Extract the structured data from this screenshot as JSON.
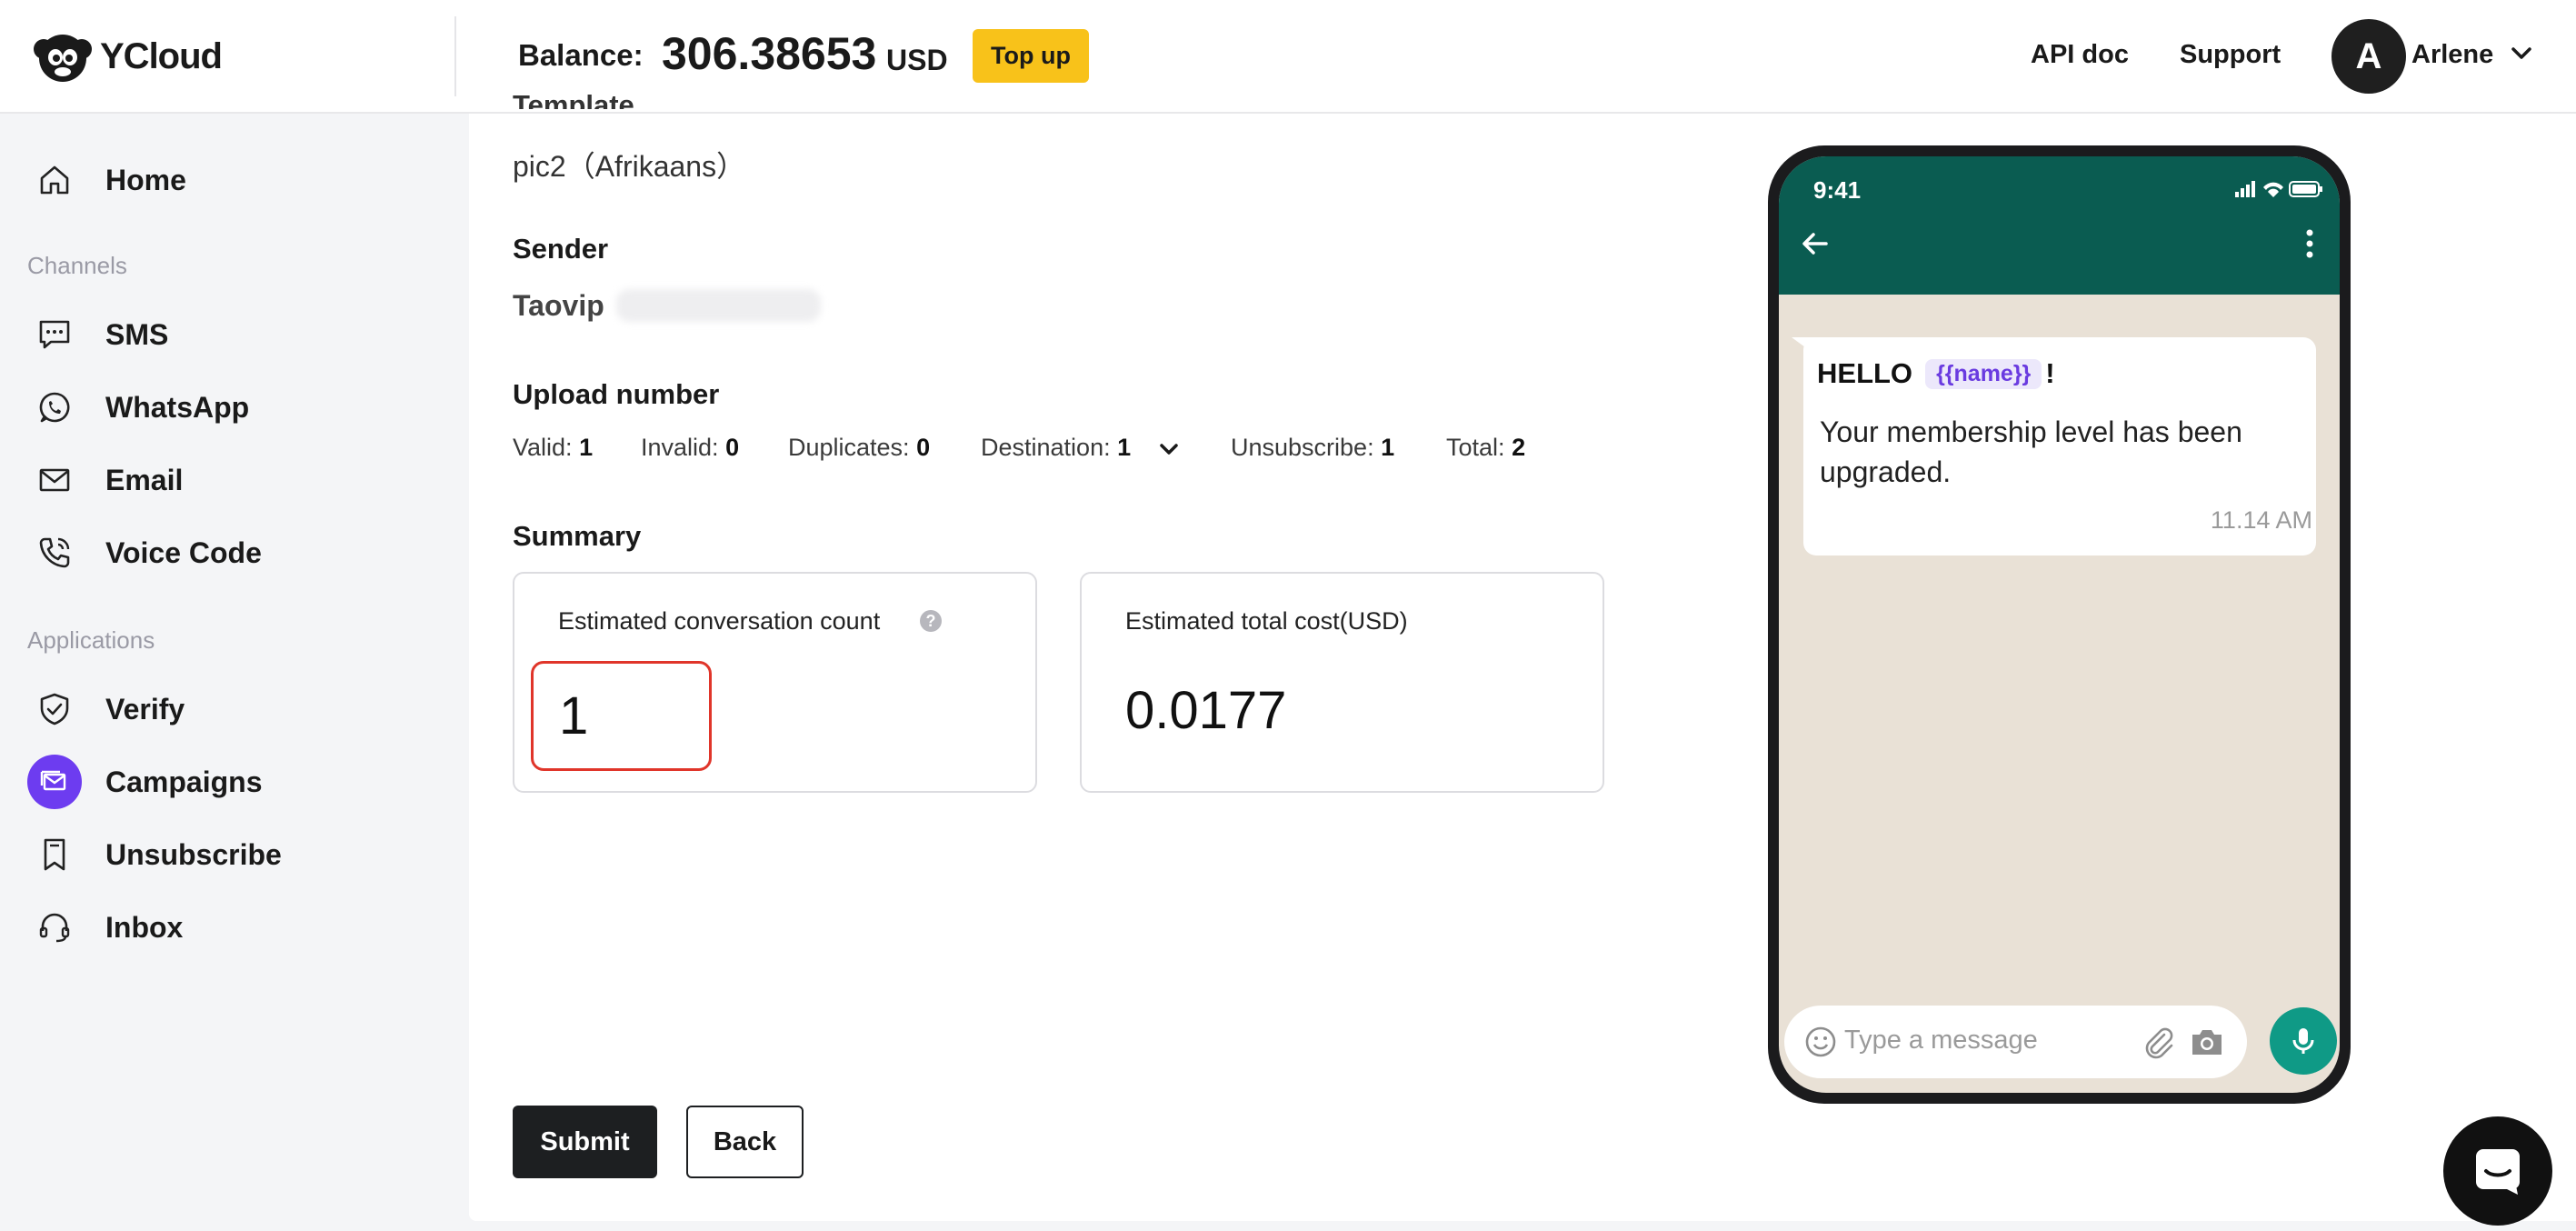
{
  "header": {
    "logo_text": "YCloud",
    "balance_label": "Balance:",
    "balance_amount": "306.38653",
    "balance_currency": "USD",
    "topup_label": "Top up",
    "api_doc_label": "API doc",
    "support_label": "Support",
    "user_initial": "A",
    "user_name": "Arlene"
  },
  "sidebar": {
    "home": "Home",
    "channels_heading": "Channels",
    "sms": "SMS",
    "whatsapp": "WhatsApp",
    "email": "Email",
    "voice_code": "Voice Code",
    "applications_heading": "Applications",
    "verify": "Verify",
    "campaigns": "Campaigns",
    "unsubscribe": "Unsubscribe",
    "inbox": "Inbox",
    "active_item": "Campaigns",
    "accent_color": "#6d3cf0"
  },
  "form": {
    "template_title_cut": "Template",
    "template_value": "pic2（Afrikaans）",
    "sender_title": "Sender",
    "sender_value": "Taovip",
    "upload_title": "Upload number",
    "stats": {
      "valid_label": "Valid:",
      "valid": "1",
      "invalid_label": "Invalid:",
      "invalid": "0",
      "duplicates_label": "Duplicates:",
      "duplicates": "0",
      "destination_label": "Destination:",
      "destination": "1",
      "unsubscribe_label": "Unsubscribe:",
      "unsubscribe": "1",
      "total_label": "Total:",
      "total": "2"
    },
    "summary_title": "Summary",
    "conv_count_label": "Estimated conversation count",
    "conv_count_value": "1",
    "total_cost_label": "Estimated total cost(USD)",
    "total_cost_value": "0.0177",
    "submit_label": "Submit",
    "back_label": "Back"
  },
  "preview": {
    "time": "9:41",
    "greeting": "HELLO",
    "variable": "{{name}}",
    "exclamation": "!",
    "body": "Your membership level has been upgraded.",
    "sent_time": "11.14 AM",
    "input_placeholder": "Type a message",
    "header_color": "#0a5c51",
    "chat_bg_color": "#e9e1d6"
  }
}
